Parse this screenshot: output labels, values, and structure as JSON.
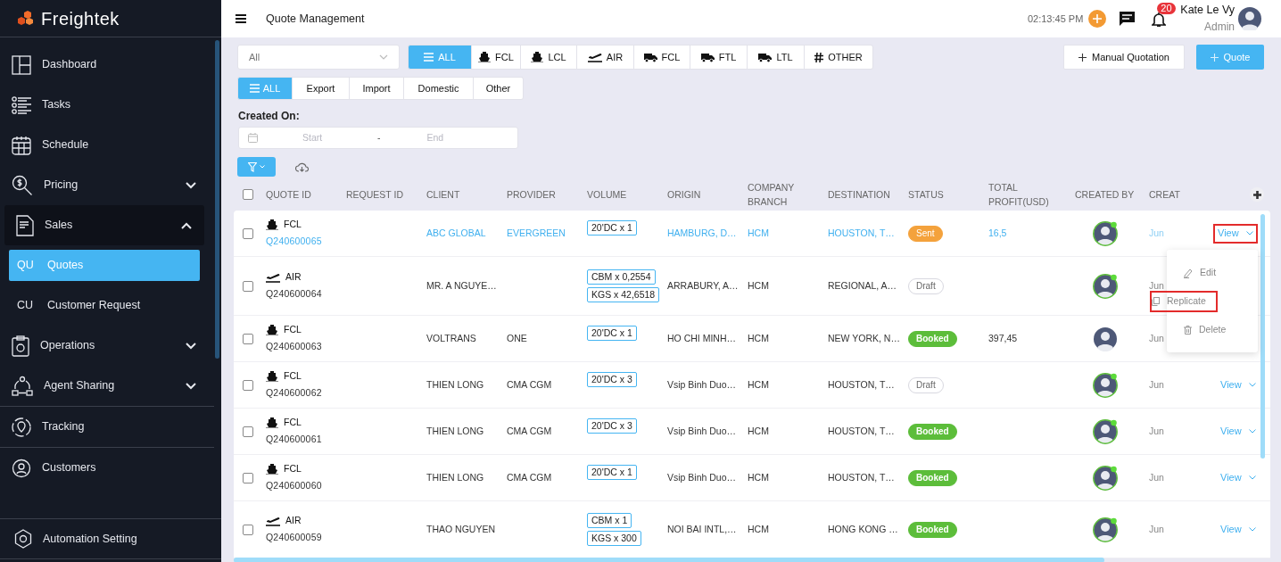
{
  "brand": "Freightek",
  "sidebar": {
    "sections": [
      [
        {
          "kind": "link",
          "label": "Dashboard"
        },
        {
          "kind": "link",
          "label": "Tasks"
        },
        {
          "kind": "link",
          "label": "Schedule"
        },
        {
          "kind": "group",
          "label": "Pricing",
          "expanded": false
        },
        {
          "kind": "group",
          "label": "Sales",
          "expanded": true,
          "children": [
            {
              "abbr": "QU",
              "label": "Quotes",
              "selected": true
            },
            {
              "abbr": "CU",
              "label": "Customer Request",
              "selected": false
            }
          ]
        },
        {
          "kind": "group",
          "label": "Operations",
          "expanded": false
        },
        {
          "kind": "group",
          "label": "Agent Sharing",
          "expanded": false
        }
      ],
      [
        {
          "kind": "link",
          "label": "Tracking"
        }
      ],
      [
        {
          "kind": "link",
          "label": "Customers"
        }
      ]
    ],
    "footer": {
      "label": "Automation Setting"
    }
  },
  "header": {
    "title": "Quote Management",
    "time": "02:13:45 PM",
    "notifications": "20",
    "user": {
      "name": "Kate Le Vy",
      "role": "Admin"
    }
  },
  "filters": {
    "select": {
      "value": "All"
    },
    "modes": [
      {
        "kind": "list",
        "label": "ALL",
        "selected": true
      },
      {
        "kind": "ship",
        "label": "FCL",
        "selected": false
      },
      {
        "kind": "ship",
        "label": "LCL",
        "selected": false
      },
      {
        "kind": "plane",
        "label": "AIR",
        "selected": false
      },
      {
        "kind": "truck",
        "label": "FCL",
        "selected": false
      },
      {
        "kind": "truck",
        "label": "FTL",
        "selected": false
      },
      {
        "kind": "truck",
        "label": "LTL",
        "selected": false
      },
      {
        "kind": "hash",
        "label": "OTHER",
        "selected": false
      }
    ],
    "directions": [
      {
        "label": "ALL",
        "selected": true
      },
      {
        "label": "Export",
        "selected": false
      },
      {
        "label": "Import",
        "selected": false
      },
      {
        "label": "Domestic",
        "selected": false
      },
      {
        "label": "Other",
        "selected": false
      }
    ],
    "created_on": {
      "label": "Created On:",
      "start_placeholder": "Start",
      "separator": "-",
      "end_placeholder": "End"
    }
  },
  "actions": [
    {
      "label": "Manual Quotation",
      "primary": false
    },
    {
      "label": "Quote",
      "primary": true
    }
  ],
  "table": {
    "all_checked": false,
    "columns": [
      "QUOTE ID",
      "REQUEST ID",
      "CLIENT",
      "PROVIDER",
      "VOLUME",
      "ORIGIN",
      "COMPANY BRANCH",
      "DESTINATION",
      "STATUS",
      "TOTAL PROFIT(USD)",
      "CREATED BY",
      "CREAT"
    ],
    "rows": [
      {
        "checked": false,
        "mode": {
          "label": "FCL",
          "kind": "ship"
        },
        "quote_id": "Q240600065",
        "highlighted": true,
        "client": "ABC GLOBAL",
        "provider": "EVERGREEN",
        "volume": [
          "20'DC x 1"
        ],
        "origin": "HAMBURG, D…",
        "branch": "HCM",
        "destination": "HOUSTON, T…",
        "status": {
          "label": "Sent",
          "kind": "sent"
        },
        "profit": "16,5",
        "online": true,
        "created": "Jun",
        "action": {
          "label": "View",
          "marked": true
        }
      },
      {
        "checked": false,
        "mode": {
          "label": "AIR",
          "kind": "plane"
        },
        "quote_id": "Q240600064",
        "highlighted": false,
        "client": "MR. A NGUYE…",
        "volume": [
          "CBM x 0,2554",
          "KGS x 42,6518"
        ],
        "origin": "ARRABURY, A…",
        "branch": "HCM",
        "destination": "REGIONAL, A…",
        "status": {
          "label": "Draft",
          "kind": "draft"
        },
        "online": true,
        "created": "Jun"
      },
      {
        "checked": false,
        "mode": {
          "label": "FCL",
          "kind": "ship"
        },
        "quote_id": "Q240600063",
        "highlighted": false,
        "client": "VOLTRANS",
        "provider": "ONE",
        "volume": [
          "20'DC x 1"
        ],
        "origin": "HO CHI MINH…",
        "branch": "HCM",
        "destination": "NEW YORK, N…",
        "status": {
          "label": "Booked",
          "kind": "booked"
        },
        "profit": "397,45",
        "online": false,
        "created": "Jun"
      },
      {
        "checked": false,
        "mode": {
          "label": "FCL",
          "kind": "ship"
        },
        "quote_id": "Q240600062",
        "highlighted": false,
        "client": "THIEN LONG",
        "provider": "CMA CGM",
        "volume": [
          "20'DC x 3"
        ],
        "origin": "Vsip Binh Duo…",
        "branch": "HCM",
        "destination": "HOUSTON, T…",
        "status": {
          "label": "Draft",
          "kind": "draft"
        },
        "online": true,
        "created": "Jun",
        "action": {
          "label": "View",
          "marked": false
        }
      },
      {
        "checked": false,
        "mode": {
          "label": "FCL",
          "kind": "ship"
        },
        "quote_id": "Q240600061",
        "highlighted": false,
        "client": "THIEN LONG",
        "provider": "CMA CGM",
        "volume": [
          "20'DC x 3"
        ],
        "origin": "Vsip Binh Duo…",
        "branch": "HCM",
        "destination": "HOUSTON, T…",
        "status": {
          "label": "Booked",
          "kind": "booked"
        },
        "online": true,
        "created": "Jun",
        "action": {
          "label": "View",
          "marked": false
        }
      },
      {
        "checked": false,
        "mode": {
          "label": "FCL",
          "kind": "ship"
        },
        "quote_id": "Q240600060",
        "highlighted": false,
        "client": "THIEN LONG",
        "provider": "CMA CGM",
        "volume": [
          "20'DC x 1"
        ],
        "origin": "Vsip Binh Duo…",
        "branch": "HCM",
        "destination": "HOUSTON, T…",
        "status": {
          "label": "Booked",
          "kind": "booked"
        },
        "online": true,
        "created": "Jun",
        "action": {
          "label": "View",
          "marked": false
        }
      },
      {
        "checked": false,
        "mode": {
          "label": "AIR",
          "kind": "plane"
        },
        "quote_id": "Q240600059",
        "highlighted": false,
        "client": "THAO NGUYEN",
        "volume": [
          "CBM x 1",
          "KGS x 300"
        ],
        "origin": "NOI BAI INTL,…",
        "branch": "HCM",
        "destination": "HONG KONG …",
        "status": {
          "label": "Booked",
          "kind": "booked"
        },
        "online": true,
        "created": "Jun",
        "action": {
          "label": "View",
          "marked": false
        }
      }
    ]
  },
  "row_menu": {
    "items": [
      {
        "kind": "edit",
        "label": "Edit",
        "marked": false
      },
      {
        "kind": "copy",
        "label": "Replicate",
        "marked": true
      },
      {
        "kind": "delete",
        "label": "Delete",
        "marked": false
      }
    ]
  }
}
